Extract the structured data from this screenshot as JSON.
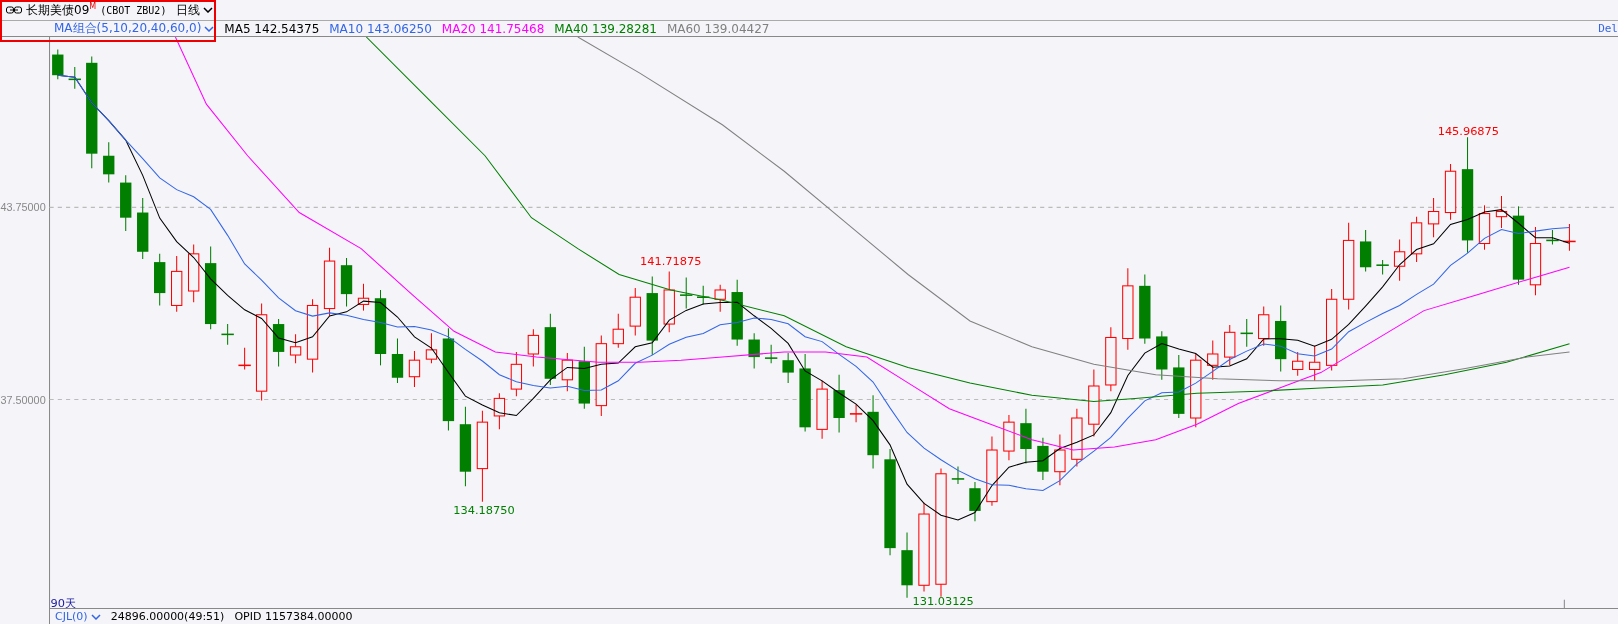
{
  "header": {
    "title": "长期美债09",
    "title_mark": "M",
    "code": "(CBOT ZBU2)",
    "period": "日线"
  },
  "indicator": {
    "name": "MA组合(5,10,20,40,60,0)",
    "extra": "Del",
    "readings": [
      {
        "label": "MA5",
        "value": "142.54375",
        "color": "#000000"
      },
      {
        "label": "MA10",
        "value": "143.06250",
        "color": "#3366e6"
      },
      {
        "label": "MA20",
        "value": "141.75468",
        "color": "#ff00ff"
      },
      {
        "label": "MA40",
        "value": "139.28281",
        "color": "#008000"
      },
      {
        "label": "MA60",
        "value": "139.04427",
        "color": "#808080"
      }
    ]
  },
  "chart": {
    "y_ticks": [
      "43.75000",
      "37.50000"
    ],
    "range": "90天",
    "price_labels": [
      {
        "text": "145.96875",
        "kind": "high"
      },
      {
        "text": "141.71875",
        "kind": "high"
      },
      {
        "text": "134.18750",
        "kind": "low"
      },
      {
        "text": "131.03125",
        "kind": "low"
      }
    ]
  },
  "volume_bar": {
    "name": "CJL(0)",
    "readings": [
      "24896.00000(49:51)",
      "OPID 1157384.00000"
    ]
  }
}
